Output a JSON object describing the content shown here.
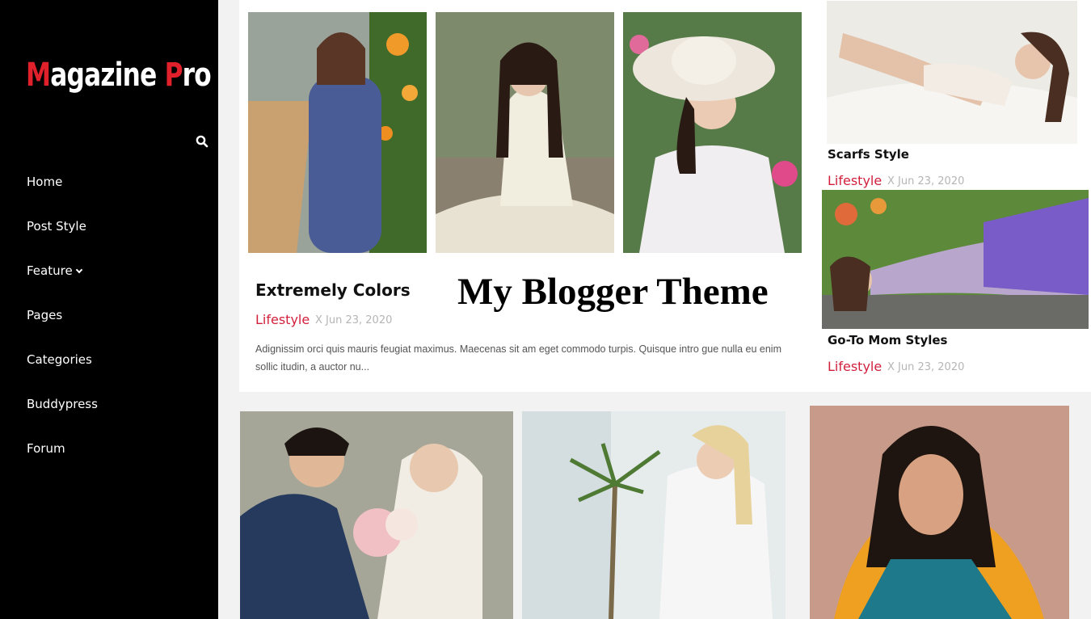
{
  "sidebar": {
    "logo": {
      "first_letter": "M",
      "first_rest": "agazine ",
      "second_letter": "P",
      "second_rest": "ro"
    },
    "search_icon": "search-icon",
    "nav": [
      {
        "label": "Home"
      },
      {
        "label": "Post Style"
      },
      {
        "label": "Feature",
        "has_dropdown": true
      },
      {
        "label": "Pages"
      },
      {
        "label": "Categories"
      },
      {
        "label": "Buddypress"
      },
      {
        "label": "Forum"
      }
    ]
  },
  "featured_post": {
    "title": "Extremely Colors",
    "category": "Lifestyle",
    "date": "X Jun 23, 2020",
    "excerpt": "Adignissim orci quis mauris feugiat maximus. Maecenas sit am eget commodo turpis. Quisque intro gue nulla eu enim sollic itudin, a auctor nu..."
  },
  "banner": {
    "text": "My Blogger Theme"
  },
  "side_posts": [
    {
      "title": "Scarfs Style",
      "category": "Lifestyle",
      "date": "X Jun 23, 2020"
    },
    {
      "title": "Go-To Mom Styles",
      "category": "Lifestyle",
      "date": "X Jun 23, 2020"
    }
  ],
  "colors": {
    "sidebar_bg": "#000000",
    "accent": "#d21f3c",
    "logo_red": "#e0202a",
    "page_bg": "#f2f2f2"
  }
}
